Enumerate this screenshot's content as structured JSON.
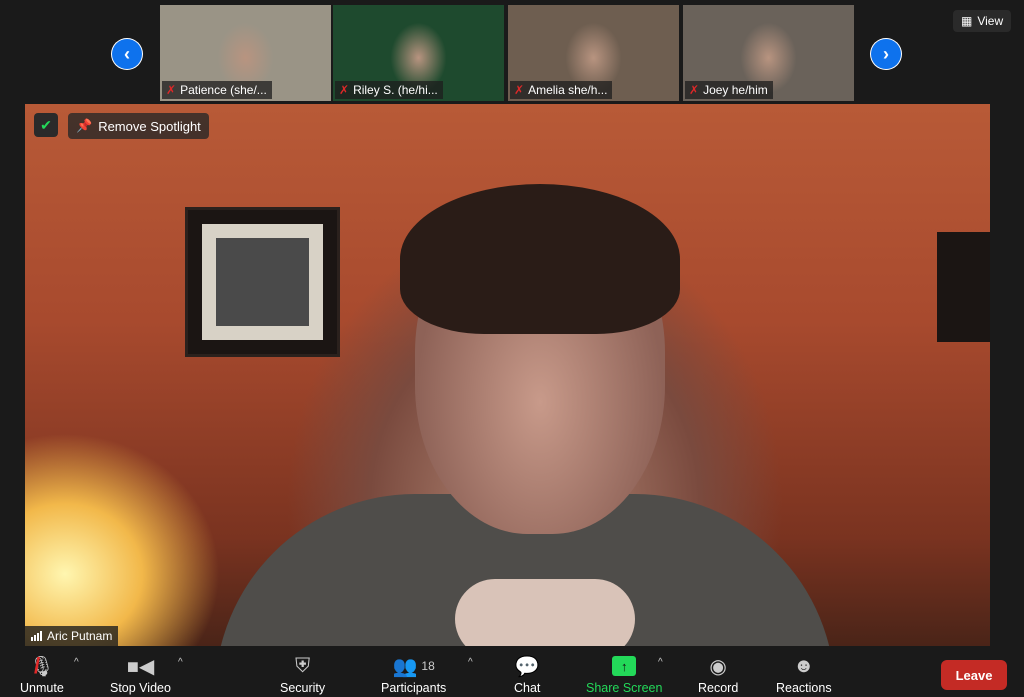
{
  "thumbnails": [
    {
      "name": "Patience (she/...",
      "bg": "#9a9486"
    },
    {
      "name": "Riley S. (he/hi...",
      "bg": "#1e4a2e"
    },
    {
      "name": "Amelia she/h...",
      "bg": "#6e5e50"
    },
    {
      "name": "Joey he/him",
      "bg": "#6a625a"
    }
  ],
  "view_label": "View",
  "spotlight_label": "Remove Spotlight",
  "main_speaker": "Aric Putnam",
  "toolbar": {
    "unmute": "Unmute",
    "stop_video": "Stop Video",
    "security": "Security",
    "participants": "Participants",
    "participant_count": "18",
    "chat": "Chat",
    "share_screen": "Share Screen",
    "record": "Record",
    "reactions": "Reactions",
    "leave": "Leave"
  },
  "colors": {
    "accent": "#0e72ed",
    "share": "#23d959",
    "leave": "#c42b25"
  }
}
